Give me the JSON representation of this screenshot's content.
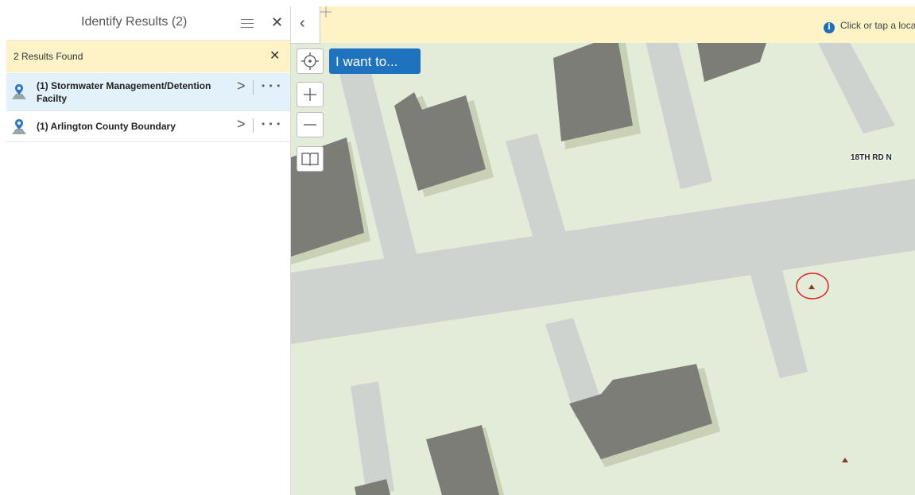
{
  "panel": {
    "title": "Identify Results (2)",
    "results_found": "2 Results Found",
    "items": [
      {
        "label_line1": "(1) Stormwater Management/Detention",
        "label_line2": "Facilty",
        "selected": true
      },
      {
        "label_line1": "(1) Arlington County Boundary",
        "label_line2": "",
        "selected": false
      }
    ]
  },
  "map": {
    "banner_text": "Click or tap a location o",
    "i_want_to_label": "I want to...",
    "road_label": "18TH RD N",
    "colors": {
      "banner": "#fdf3c6",
      "accent": "#1f73be",
      "marker": "#8b3a1f",
      "annotation_circle": "#e02020"
    }
  }
}
